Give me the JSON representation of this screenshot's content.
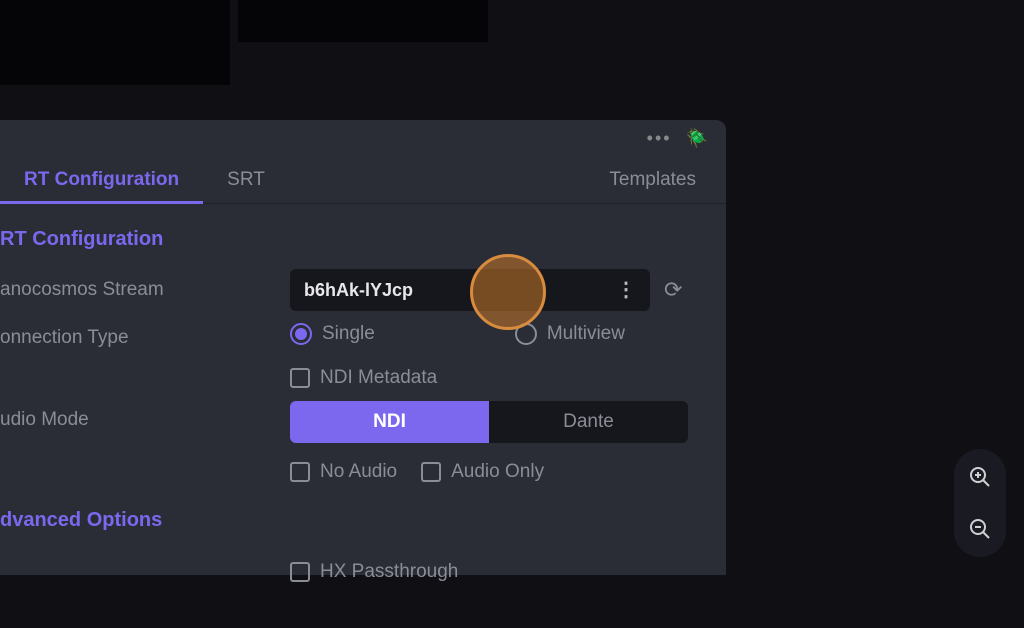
{
  "tabs": {
    "active": "RT Configuration",
    "srt": "SRT",
    "templates": "Templates"
  },
  "section": {
    "heading": "RT Configuration",
    "stream_label": "anocosmos Stream",
    "stream_value": "b6hAk-lYJcp",
    "connection_label": "onnection Type",
    "radio_single": "Single",
    "radio_multiview": "Multiview",
    "ndi_metadata": "NDI Metadata",
    "audio_label": "udio Mode",
    "toggle_ndi": "NDI",
    "toggle_dante": "Dante",
    "no_audio": "No Audio",
    "audio_only": "Audio Only"
  },
  "advanced": {
    "heading": "dvanced Options",
    "hx_passthrough": "HX Passthrough"
  }
}
